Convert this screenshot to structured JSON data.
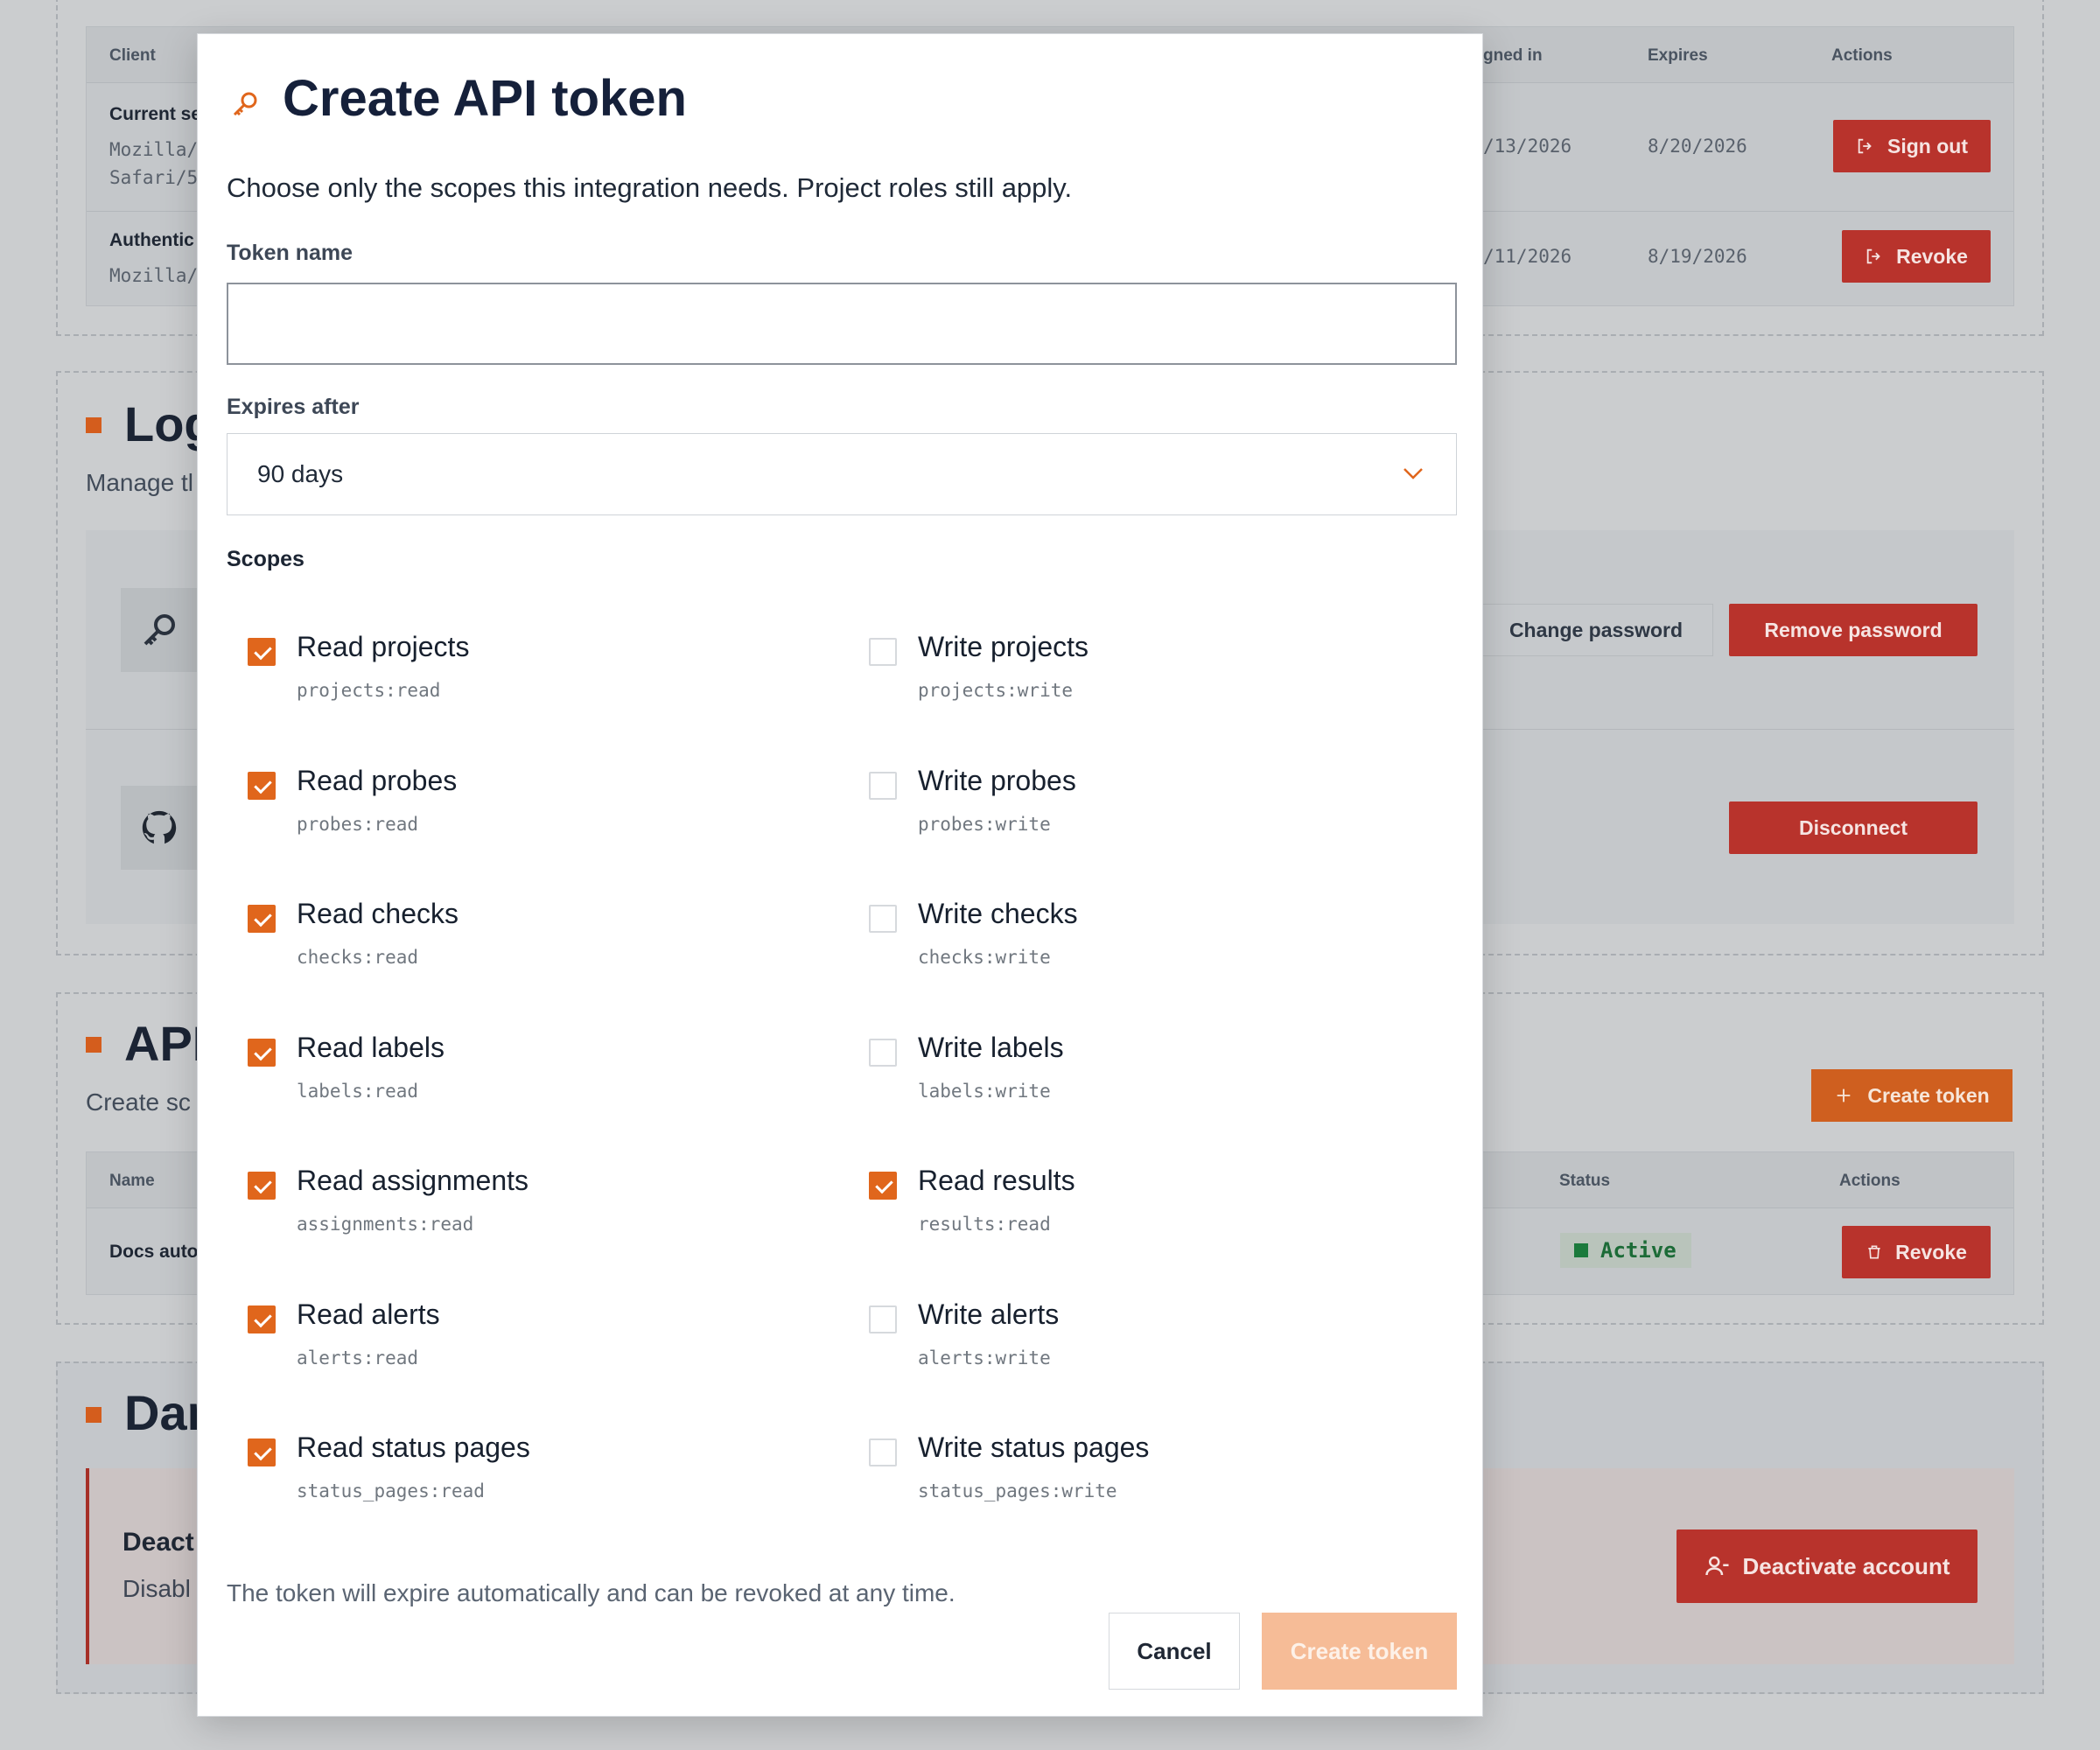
{
  "background": {
    "sessions_table": {
      "headers": {
        "client": "Client",
        "signed_in": "gned in",
        "expires": "Expires",
        "actions": "Actions"
      },
      "rows": [
        {
          "client_title": "Current se",
          "client_ua_1": "Mozilla/",
          "client_ua_2": "Safari/5",
          "signed_in": "/13/2026",
          "expires": "8/20/2026",
          "action": "Sign out"
        },
        {
          "client_title": "Authentic",
          "client_ua_1": "Mozilla/",
          "signed_in": "/11/2026",
          "expires": "8/19/2026",
          "action": "Revoke"
        }
      ]
    },
    "login_section": {
      "title": "Log",
      "subtitle": "Manage tl",
      "change_password": "Change password",
      "remove_password": "Remove password",
      "disconnect": "Disconnect"
    },
    "api_section": {
      "title": "API",
      "subtitle": "Create sc",
      "create_token": "Create token",
      "headers": {
        "name": "Name",
        "status": "Status",
        "actions": "Actions"
      },
      "row": {
        "name": "Docs auto",
        "status": "Active",
        "action": "Revoke"
      }
    },
    "danger_section": {
      "title": "Dar",
      "card_title": "Deact",
      "card_sub": "Disabl",
      "deactivate": "Deactivate account"
    }
  },
  "modal": {
    "title": "Create API token",
    "icon": "key-icon",
    "description": "Choose only the scopes this integration needs. Project roles still apply.",
    "token_name_label": "Token name",
    "token_name_value": "",
    "expires_label": "Expires after",
    "expires_value": "90 days",
    "scopes_label": "Scopes",
    "scopes": [
      {
        "name": "Read projects",
        "code": "projects:read",
        "checked": true
      },
      {
        "name": "Write projects",
        "code": "projects:write",
        "checked": false
      },
      {
        "name": "Read probes",
        "code": "probes:read",
        "checked": true
      },
      {
        "name": "Write probes",
        "code": "probes:write",
        "checked": false
      },
      {
        "name": "Read checks",
        "code": "checks:read",
        "checked": true
      },
      {
        "name": "Write checks",
        "code": "checks:write",
        "checked": false
      },
      {
        "name": "Read labels",
        "code": "labels:read",
        "checked": true
      },
      {
        "name": "Write labels",
        "code": "labels:write",
        "checked": false
      },
      {
        "name": "Read assignments",
        "code": "assignments:read",
        "checked": true
      },
      {
        "name": "Read results",
        "code": "results:read",
        "checked": true
      },
      {
        "name": "Read alerts",
        "code": "alerts:read",
        "checked": true
      },
      {
        "name": "Write alerts",
        "code": "alerts:write",
        "checked": false
      },
      {
        "name": "Read status pages",
        "code": "status_pages:read",
        "checked": true
      },
      {
        "name": "Write status pages",
        "code": "status_pages:write",
        "checked": false
      }
    ],
    "note": "The token will expire automatically and can be revoked at any time.",
    "cancel": "Cancel",
    "create": "Create token"
  },
  "colors": {
    "accent": "#e0661c",
    "danger": "#b8332c",
    "create_disabled": "#f6bc97",
    "active_green": "#1b7a3c"
  }
}
